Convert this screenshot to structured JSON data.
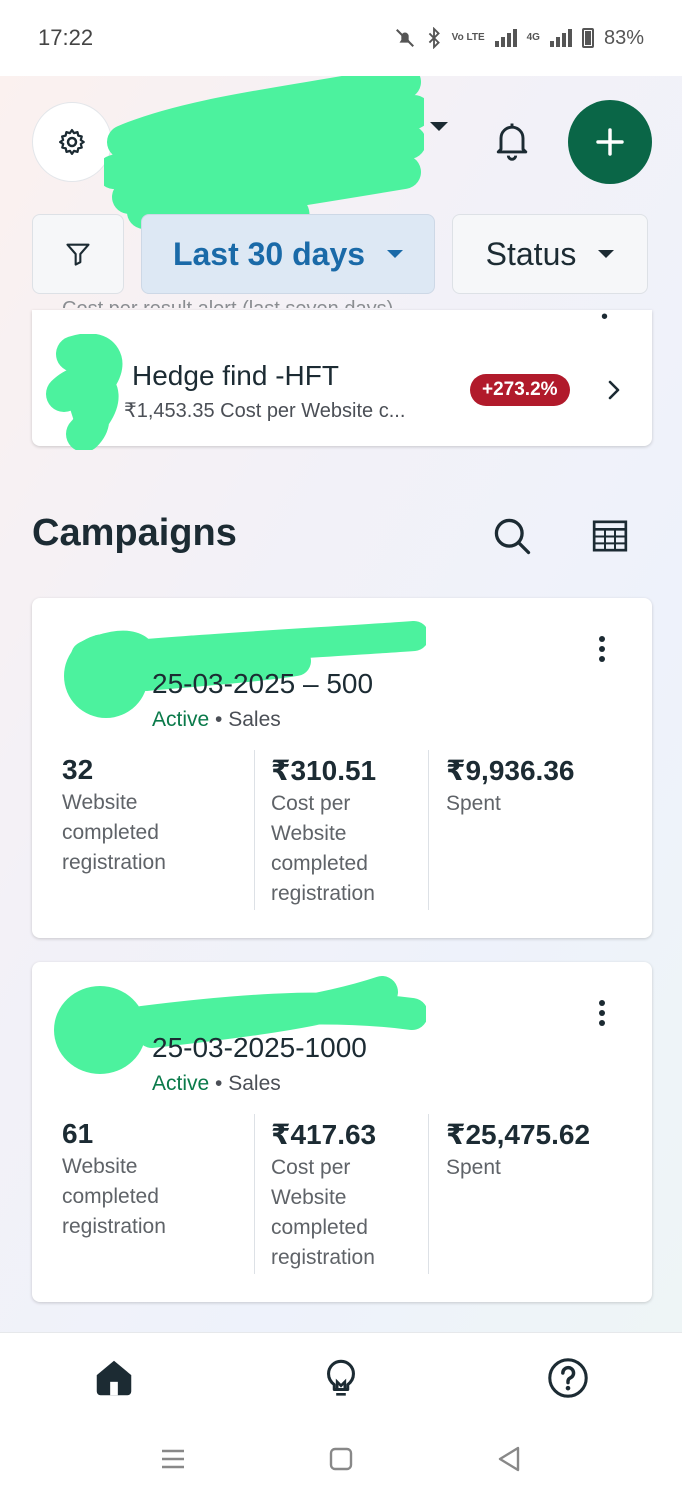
{
  "status_bar": {
    "time": "17:22",
    "network_label": "4G",
    "volte_label": "Vo LTE",
    "battery": "83%",
    "icons": [
      "bell-off-icon",
      "bluetooth-icon",
      "signal-icon",
      "battery-icon"
    ]
  },
  "header": {
    "account_name": "",
    "icons": [
      "gear-icon",
      "chevron-down-icon",
      "bell-icon",
      "plus-icon"
    ]
  },
  "filters": {
    "filter_icon": "funnel-icon",
    "date_range": "Last 30 days",
    "status": "Status"
  },
  "ad_card": {
    "cut_text": "Cost per result alert (last seven days)",
    "name": "Hedge find -HFT",
    "subtitle": "₹1,453.35  Cost per Website c...",
    "badge": "+273.2%",
    "badge_color": "#b11a2b"
  },
  "campaigns": {
    "title": "Campaigns",
    "items": [
      {
        "title": "25-03-2025 – 500",
        "status": "Active",
        "separator": "•",
        "objective": "Sales",
        "metrics": [
          {
            "value": "32",
            "label": "Website completed registration"
          },
          {
            "value": "₹310.51",
            "label": "Cost per Website completed registration"
          },
          {
            "value": "₹9,936.36",
            "label": "Spent"
          }
        ]
      },
      {
        "title": "25-03-2025-1000",
        "status": "Active",
        "separator": "•",
        "objective": "Sales",
        "metrics": [
          {
            "value": "61",
            "label": "Website completed registration"
          },
          {
            "value": "₹417.63",
            "label": "Cost per Website completed registration"
          },
          {
            "value": "₹25,475.62",
            "label": "Spent"
          }
        ]
      }
    ]
  },
  "bottom_nav": {
    "items": [
      "home-icon",
      "lightbulb-icon",
      "help-icon"
    ]
  },
  "colors": {
    "brand_green": "#0a6647",
    "active_green": "#0a7a4a",
    "link_blue": "#1a6aa8",
    "redaction": "#4cf29e"
  }
}
